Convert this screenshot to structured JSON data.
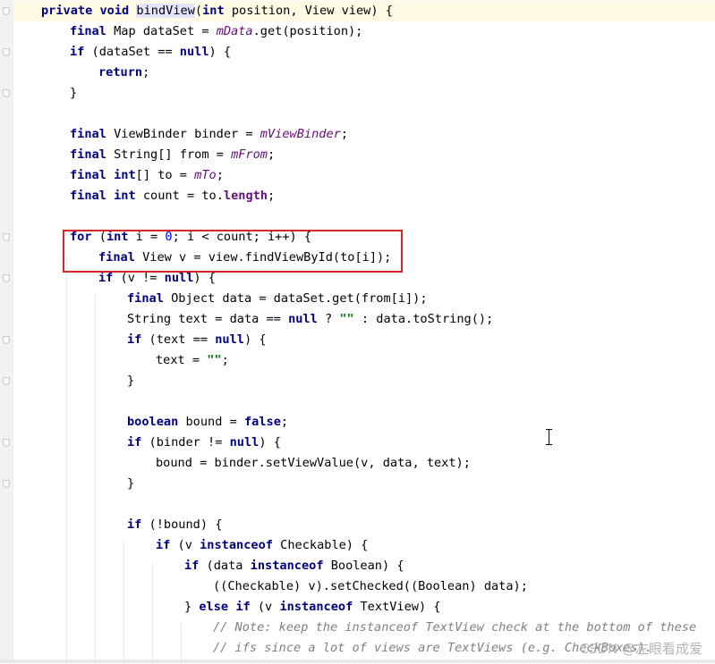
{
  "editor": {
    "language": "java",
    "lines": [
      {
        "text": "private void bindView(int position, View view) {"
      },
      {
        "text": "final Map dataSet = mData.get(position);"
      },
      {
        "text": "if (dataSet == null) {"
      },
      {
        "text": "return;"
      },
      {
        "text": "}"
      },
      {
        "text": ""
      },
      {
        "text": "final ViewBinder binder = mViewBinder;"
      },
      {
        "text": "final String[] from = mFrom;"
      },
      {
        "text": "final int[] to = mTo;"
      },
      {
        "text": "final int count = to.length;"
      },
      {
        "text": ""
      },
      {
        "text": "for (int i = 0; i < count; i++) {"
      },
      {
        "text": "final View v = view.findViewById(to[i]);"
      },
      {
        "text": "if (v != null) {"
      },
      {
        "text": "final Object data = dataSet.get(from[i]);"
      },
      {
        "text": "String text = data == null ? \"\" : data.toString();"
      },
      {
        "text": "if (text == null) {"
      },
      {
        "text": "text = \"\";"
      },
      {
        "text": "}"
      },
      {
        "text": ""
      },
      {
        "text": "boolean bound = false;"
      },
      {
        "text": "if (binder != null) {"
      },
      {
        "text": "bound = binder.setViewValue(v, data, text);"
      },
      {
        "text": "}"
      },
      {
        "text": ""
      },
      {
        "text": "if (!bound) {"
      },
      {
        "text": "if (v instanceof Checkable) {"
      },
      {
        "text": "if (data instanceof Boolean) {"
      },
      {
        "text": "((Checkable) v).setChecked((Boolean) data);"
      },
      {
        "text": "} else if (v instanceof TextView) {"
      },
      {
        "text": "// Note: keep the instanceof TextView check at the bottom of these"
      },
      {
        "text": "// ifs since a lot of views are TextViews (e.g. CheckBoxes)."
      }
    ]
  },
  "annotation": {
    "highlight": "for-loop first two lines"
  },
  "watermark": "CSDN @左眼看成爱",
  "colors": {
    "keyword": "#000080",
    "field": "#660e7a",
    "number": "#0000ff",
    "string": "#008000",
    "comment": "#808080",
    "annotation_box": "#d9262a",
    "current_line": "#fffae3"
  },
  "icons": {
    "gutter": "intention-bulb-icon",
    "fold": "fold-marker-icon"
  }
}
